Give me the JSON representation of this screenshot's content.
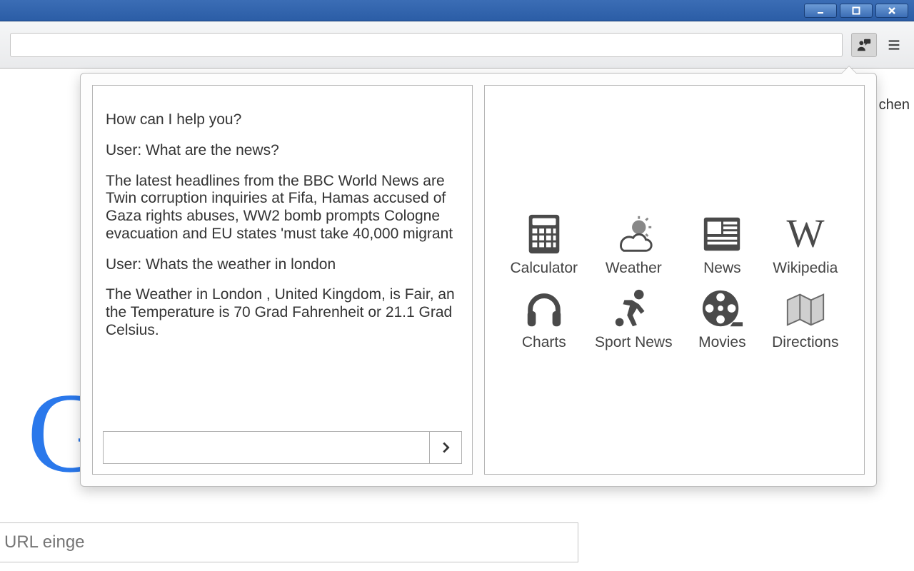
{
  "titlebar": {
    "minimize": "minimize",
    "maximize": "maximize",
    "close": "close"
  },
  "toolbar": {
    "address_value": "",
    "extension_name": "assistant-extension",
    "menu_name": "hamburger-menu"
  },
  "background_page": {
    "partial_right_text": "chen",
    "google_letter": "G",
    "search_placeholder": "URL einge"
  },
  "popup": {
    "chat": {
      "lines": [
        "How can I help you?",
        "User: What are the news?",
        "The latest headlines from the BBC World News are Twin corruption inquiries at Fifa, Hamas accused of Gaza rights abuses, WW2 bomb prompts Cologne evacuation and EU states 'must take 40,000 migrant",
        "User: Whats the weather in london",
        "The Weather in London , United Kingdom, is Fair, an the Temperature is 70 Grad Fahrenheit or 21.1 Grad Celsius."
      ],
      "input_value": "",
      "send_label": "send"
    },
    "tools": [
      {
        "icon": "calculator-icon",
        "label": "Calculator"
      },
      {
        "icon": "weather-icon",
        "label": "Weather"
      },
      {
        "icon": "news-icon",
        "label": "News"
      },
      {
        "icon": "wikipedia-icon",
        "label": "Wikipedia"
      },
      {
        "icon": "charts-icon",
        "label": "Charts"
      },
      {
        "icon": "sport-news-icon",
        "label": "Sport News"
      },
      {
        "icon": "movies-icon",
        "label": "Movies"
      },
      {
        "icon": "directions-icon",
        "label": "Directions"
      }
    ]
  }
}
